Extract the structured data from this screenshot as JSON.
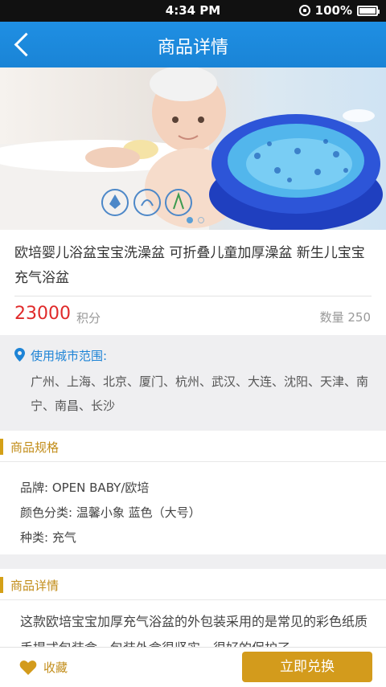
{
  "status_bar": {
    "time": "4:34 PM",
    "battery": "100%"
  },
  "nav": {
    "title": "商品详情"
  },
  "banner": {
    "dots": [
      true,
      false
    ]
  },
  "product": {
    "name": "欧培婴儿浴盆宝宝洗澡盆 可折叠儿童加厚澡盆 新生儿宝宝充气浴盆",
    "price": "23000",
    "price_unit": "积分",
    "stock": "数量 250"
  },
  "city": {
    "title": "使用城市范围:",
    "list": "广州、上海、北京、厦门、杭州、武汉、大连、沈阳、天津、南宁、南昌、长沙"
  },
  "specs": {
    "title": "商品规格",
    "items": [
      "品牌: OPEN BABY/欧培",
      "颜色分类: 温馨小象 蓝色（大号）",
      "种类: 充气"
    ]
  },
  "details": {
    "title": "商品详情",
    "text": "这款欧培宝宝加厚充气浴盆的外包装采用的是常见的彩色纸质手提式包装盒，包装外盒很坚实，很好的保护了"
  },
  "bottom": {
    "favorite": "收藏",
    "redeem": "立即兑换"
  },
  "colors": {
    "nav_blue": "#1f8fe3",
    "price_red": "#e02a2a",
    "accent_gold": "#d39b1c"
  }
}
